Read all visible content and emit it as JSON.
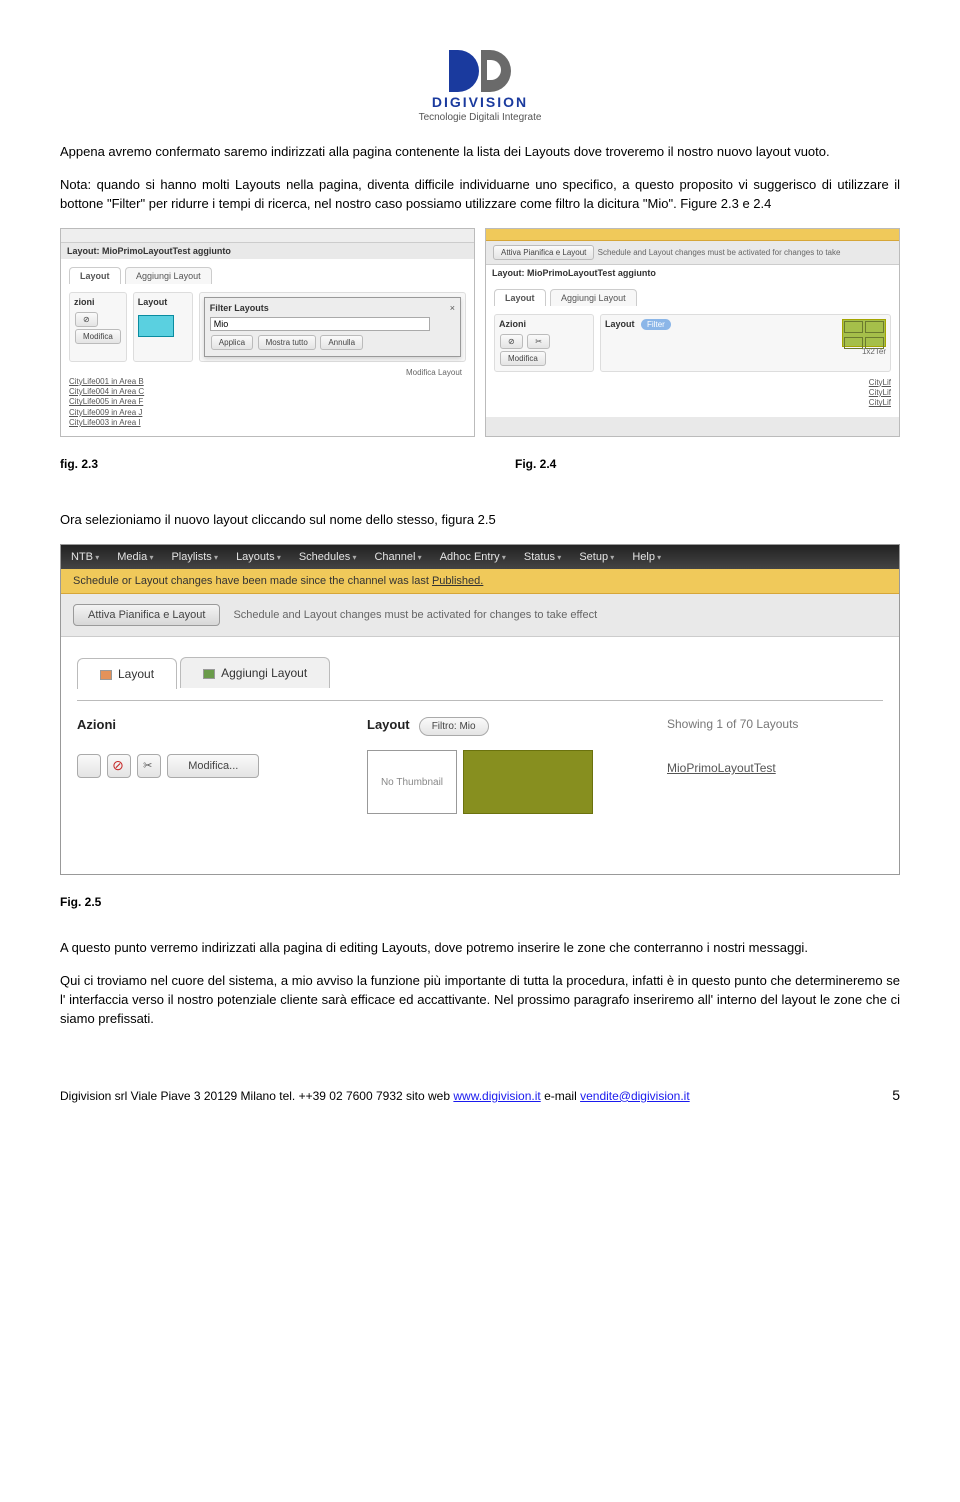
{
  "logo": {
    "name": "DIGIVISION",
    "tagline": "Tecnologie Digitali Integrate"
  },
  "p1": "Appena avremo confermato saremo indirizzati alla pagina contenente la lista dei Layouts dove  troveremo il nostro nuovo layout vuoto.",
  "p2": "Nota: quando si hanno molti Layouts  nella pagina, diventa difficile individuarne uno specifico, a questo proposito vi suggerisco di utilizzare il bottone \"Filter\" per ridurre i tempi di ricerca, nel nostro caso possiamo utilizzare come filtro la dicitura \"Mio\". Figure 2.3 e 2.4",
  "shot1": {
    "title_line": "Layout: MioPrimoLayoutTest aggiunto",
    "tab1": "Layout",
    "tab2": "Aggiungi Layout",
    "panel_l": "zioni",
    "panel_m": "Layout",
    "panel_r_h": "Filter Layouts",
    "filter_val": "Mio",
    "applica": "Applica",
    "mostra": "Mostra tutto",
    "annulla": "Annulla",
    "modifica": "Modifica",
    "modlabel": "Modifica Layout",
    "items": [
      "CityLife001 in Area B",
      "CityLife004 in Area C",
      "CityLife005 in Area F",
      "CityLife009 in Area J",
      "CityLife003 in Area I"
    ]
  },
  "shot2": {
    "note_top": "Schedule and Layout changes must be activated for changes to take",
    "pill": "Attiva Pianifica e Layout",
    "title_line": "Layout: MioPrimoLayoutTest aggiunto",
    "tab1": "Layout",
    "tab2": "Aggiungi Layout",
    "panel_l": "Azioni",
    "panel_m": "Layout",
    "filter": "Filter",
    "modifica": "Modifica",
    "tright": "1x2Ter",
    "items": [
      "CityLif",
      "CityLif",
      "CityLif"
    ]
  },
  "cap1": "fig. 2.3",
  "cap2": "Fig. 2.4",
  "p3": "Ora selezioniamo il nuovo layout cliccando sul nome dello stesso, figura 2.5",
  "bigshot": {
    "nav": [
      "NTB",
      "Media",
      "Playlists",
      "Layouts",
      "Schedules",
      "Channel",
      "Adhoc Entry",
      "Status",
      "Setup",
      "Help"
    ],
    "yellow_pref": "Schedule or Layout changes have been made since the channel was last ",
    "yellow_link": "Published.",
    "notice_btn": "Attiva Pianifica e Layout",
    "notice_msg": "Schedule and Layout changes must be activated for changes to take effect",
    "tab1": "Layout",
    "tab2": "Aggiungi Layout",
    "col_azioni": "Azioni",
    "col_layout": "Layout",
    "modifica": "Modifica...",
    "filtro": "Filtro: Mio",
    "showing": "Showing 1 of 70 Layouts",
    "no_thumb": "No Thumbnail",
    "layout_name": "MioPrimoLayoutTest"
  },
  "cap3": "Fig. 2.5",
  "p4": "A questo punto verremo indirizzati alla pagina di editing Layouts, dove potremo inserire le zone che conterranno i nostri messaggi.",
  "p5": "Qui ci troviamo nel cuore del sistema, a mio avviso la funzione più importante di tutta la procedura, infatti è in questo punto che determineremo se l' interfaccia verso il nostro potenziale cliente sarà efficace ed accattivante. Nel prossimo paragrafo inseriremo all' interno del layout le zone che ci siamo prefissati.",
  "footer": {
    "text_pre": "Digivision srl Viale Piave 3 20129 Milano tel. ++39 02 7600 7932 sito web ",
    "web": "www.digivision.it",
    "mid": " e-mail ",
    "email": "vendite@digivision.it",
    "page": "5"
  }
}
